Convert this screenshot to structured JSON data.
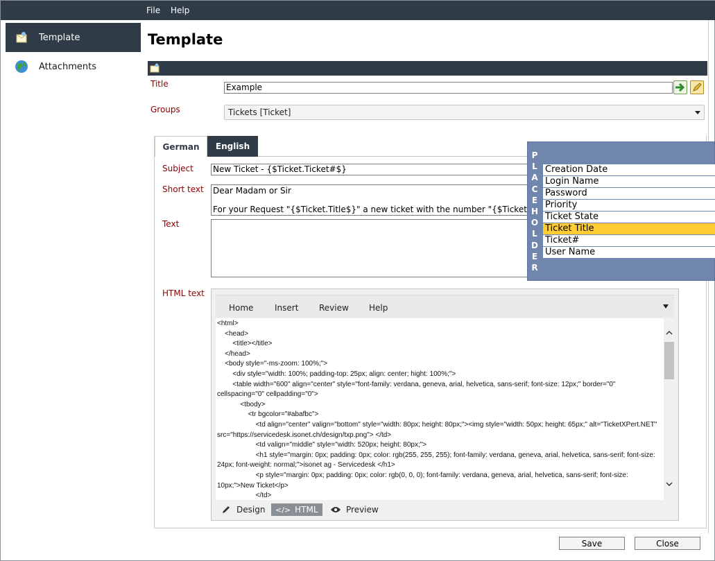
{
  "menu": {
    "file": "File",
    "help": "Help"
  },
  "sidebar": {
    "items": [
      {
        "label": "Template",
        "icon": "template-icon"
      },
      {
        "label": "Attachments",
        "icon": "globe-icon"
      }
    ]
  },
  "page": {
    "title": "Template"
  },
  "form": {
    "title_label": "Title",
    "title_value": "Example",
    "groups_label": "Groups",
    "groups_value": "Tickets [Ticket]",
    "tabs": [
      "German",
      "English"
    ],
    "subject_label": "Subject",
    "subject_value": "New Ticket - {$Ticket.Ticket#$}",
    "short_text_label": "Short text",
    "short_text_line1": "Dear Madam or Sir",
    "short_text_line2": "For your Request \"{$Ticket.Title$}\" a new ticket with the number \"{$Ticket.Ticket",
    "text_label": "Text",
    "html_text_label": "HTML text"
  },
  "editor": {
    "ribbon": [
      "Home",
      "Insert",
      "Review",
      "Help"
    ],
    "code_lines": [
      "<html>",
      "    <head>",
      "        <title></title>",
      "    </head>",
      "    <body style=\"-ms-zoom: 100%;\">",
      "        <div style=\"width: 100%; padding-top: 25px; align: center; hight: 100%;\">",
      "        <table width=\"600\" align=\"center\" style=\"font-family: verdana, geneva, arial, helvetica, sans-serif; font-size: 12px;\" border=\"0\" cellspacing=\"0\" cellpadding=\"0\">",
      "            <tbody>",
      "                <tr bgcolor=\"#abafbc\">",
      "                    <td align=\"center\" valign=\"bottom\" style=\"width: 80px; height: 80px;\"><img style=\"width: 50px; height: 65px;\" alt=\"TicketXPert.NET\" src=\"https://servicedesk.isonet.ch/design/txp.png\"> </td>",
      "                    <td valign=\"middle\" style=\"width: 520px; height: 80px;\">",
      "                    <h1 style=\"margin: 0px; padding: 0px; color: rgb(255, 255, 255); font-family: verdana, geneva, arial, helvetica, sans-serif; font-size: 24px; font-weight: normal;\">isonet ag - Servicedesk </h1>",
      "                    <p style=\"margin: 0px; padding: 0px; color: rgb(0, 0, 0); font-family: verdana, geneva, arial, helvetica, sans-serif; font-size: 10px;\">New Ticket</p>",
      "                    </td>"
    ],
    "modes": [
      "Design",
      "HTML",
      "Preview"
    ]
  },
  "placeholder": {
    "letters": [
      "P",
      "L",
      "A",
      "C",
      "E",
      "H",
      "O",
      "L",
      "D",
      "E",
      "R"
    ],
    "items": [
      "Creation Date",
      "Login Name",
      "Password",
      "Priority",
      "Ticket State",
      "Ticket Title",
      "Ticket#",
      "User Name"
    ],
    "selected": "Ticket Title"
  },
  "buttons": {
    "save": "Save",
    "close": "Close"
  },
  "colors": {
    "header": "#2f3b47",
    "label": "#8b0000",
    "placeholder_bg": "#7186ad",
    "highlight": "#ffcc33"
  }
}
